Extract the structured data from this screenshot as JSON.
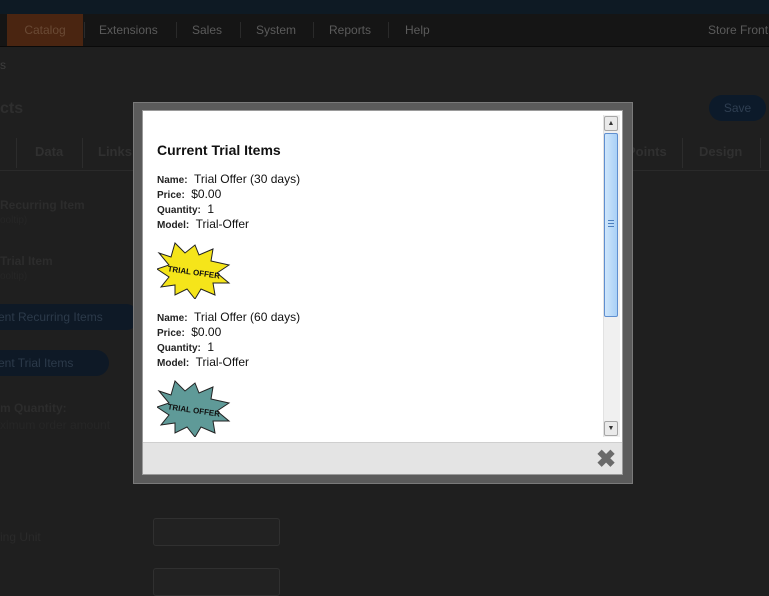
{
  "menu": {
    "items": [
      "Catalog",
      "Extensions",
      "Sales",
      "System",
      "Reports",
      "Help"
    ],
    "store_front": "Store Front"
  },
  "breadcrumb": "s",
  "page_title": "cts",
  "save_label": "Save",
  "tabs": [
    "Data",
    "Links",
    "Points",
    "Design"
  ],
  "form": {
    "recurring_label": "Recurring Item",
    "recurring_hint": "ooltip)",
    "trial_label": "Trial Item",
    "trial_hint": "ooltip)",
    "current_recurring_btn": "rent Recurring Items",
    "current_trial_btn": "rent Trial Items",
    "min_qty_label": "m Quantity:",
    "min_qty_hint": "ximum order amount",
    "unit_label": "ing Unit"
  },
  "modal": {
    "title": "Current Trial Items",
    "labels": {
      "name": "Name:",
      "price": "Price:",
      "quantity": "Quantity:",
      "model": "Model:"
    },
    "items": [
      {
        "name": "Trial Offer (30 days)",
        "price": "$0.00",
        "quantity": "1",
        "model": "Trial-Offer",
        "badge_text": "TRIAL OFFER",
        "badge_color": "#f5e51a"
      },
      {
        "name": "Trial Offer (60 days)",
        "price": "$0.00",
        "quantity": "1",
        "model": "Trial-Offer",
        "badge_text": "TRIAL OFFER",
        "badge_color": "#5f9a98"
      }
    ],
    "close_icon": "close-icon"
  }
}
